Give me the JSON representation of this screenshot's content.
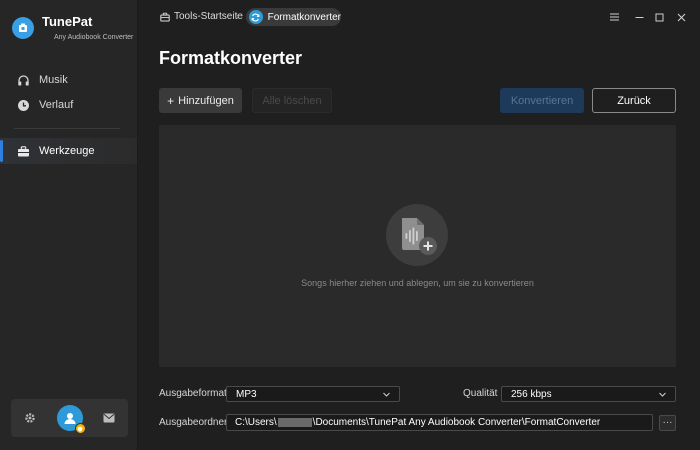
{
  "app": {
    "name": "TunePat",
    "subtitle": "Any Audiobook Converter"
  },
  "sidebar": {
    "items": [
      {
        "label": "Musik",
        "icon": "headphones-icon"
      },
      {
        "label": "Verlauf",
        "icon": "clock-icon"
      },
      {
        "label": "Werkzeuge",
        "icon": "toolbox-icon",
        "active": true
      }
    ]
  },
  "breadcrumb": {
    "root": "Tools-Startseite",
    "current": "Formatkonverter"
  },
  "page": {
    "title": "Formatkonverter"
  },
  "toolbar": {
    "add_label": "Hinzufügen",
    "delete_label": "Alle löschen",
    "convert_label": "Konvertieren",
    "back_label": "Zurück"
  },
  "dropzone": {
    "hint": "Songs hierher ziehen und ablegen, um sie zu konvertieren"
  },
  "settings": {
    "format_label": "Ausgabeformat",
    "format_value": "MP3",
    "quality_label": "Qualität",
    "quality_value": "256 kbps",
    "folder_label": "Ausgabeordner",
    "folder_prefix": "C:\\Users\\",
    "folder_suffix": "\\Documents\\TunePat Any Audiobook Converter\\FormatConverter",
    "more_label": "···"
  },
  "colors": {
    "accent": "#2f7fe0",
    "brand": "#3aa0e6",
    "badge": "#f5b300"
  }
}
